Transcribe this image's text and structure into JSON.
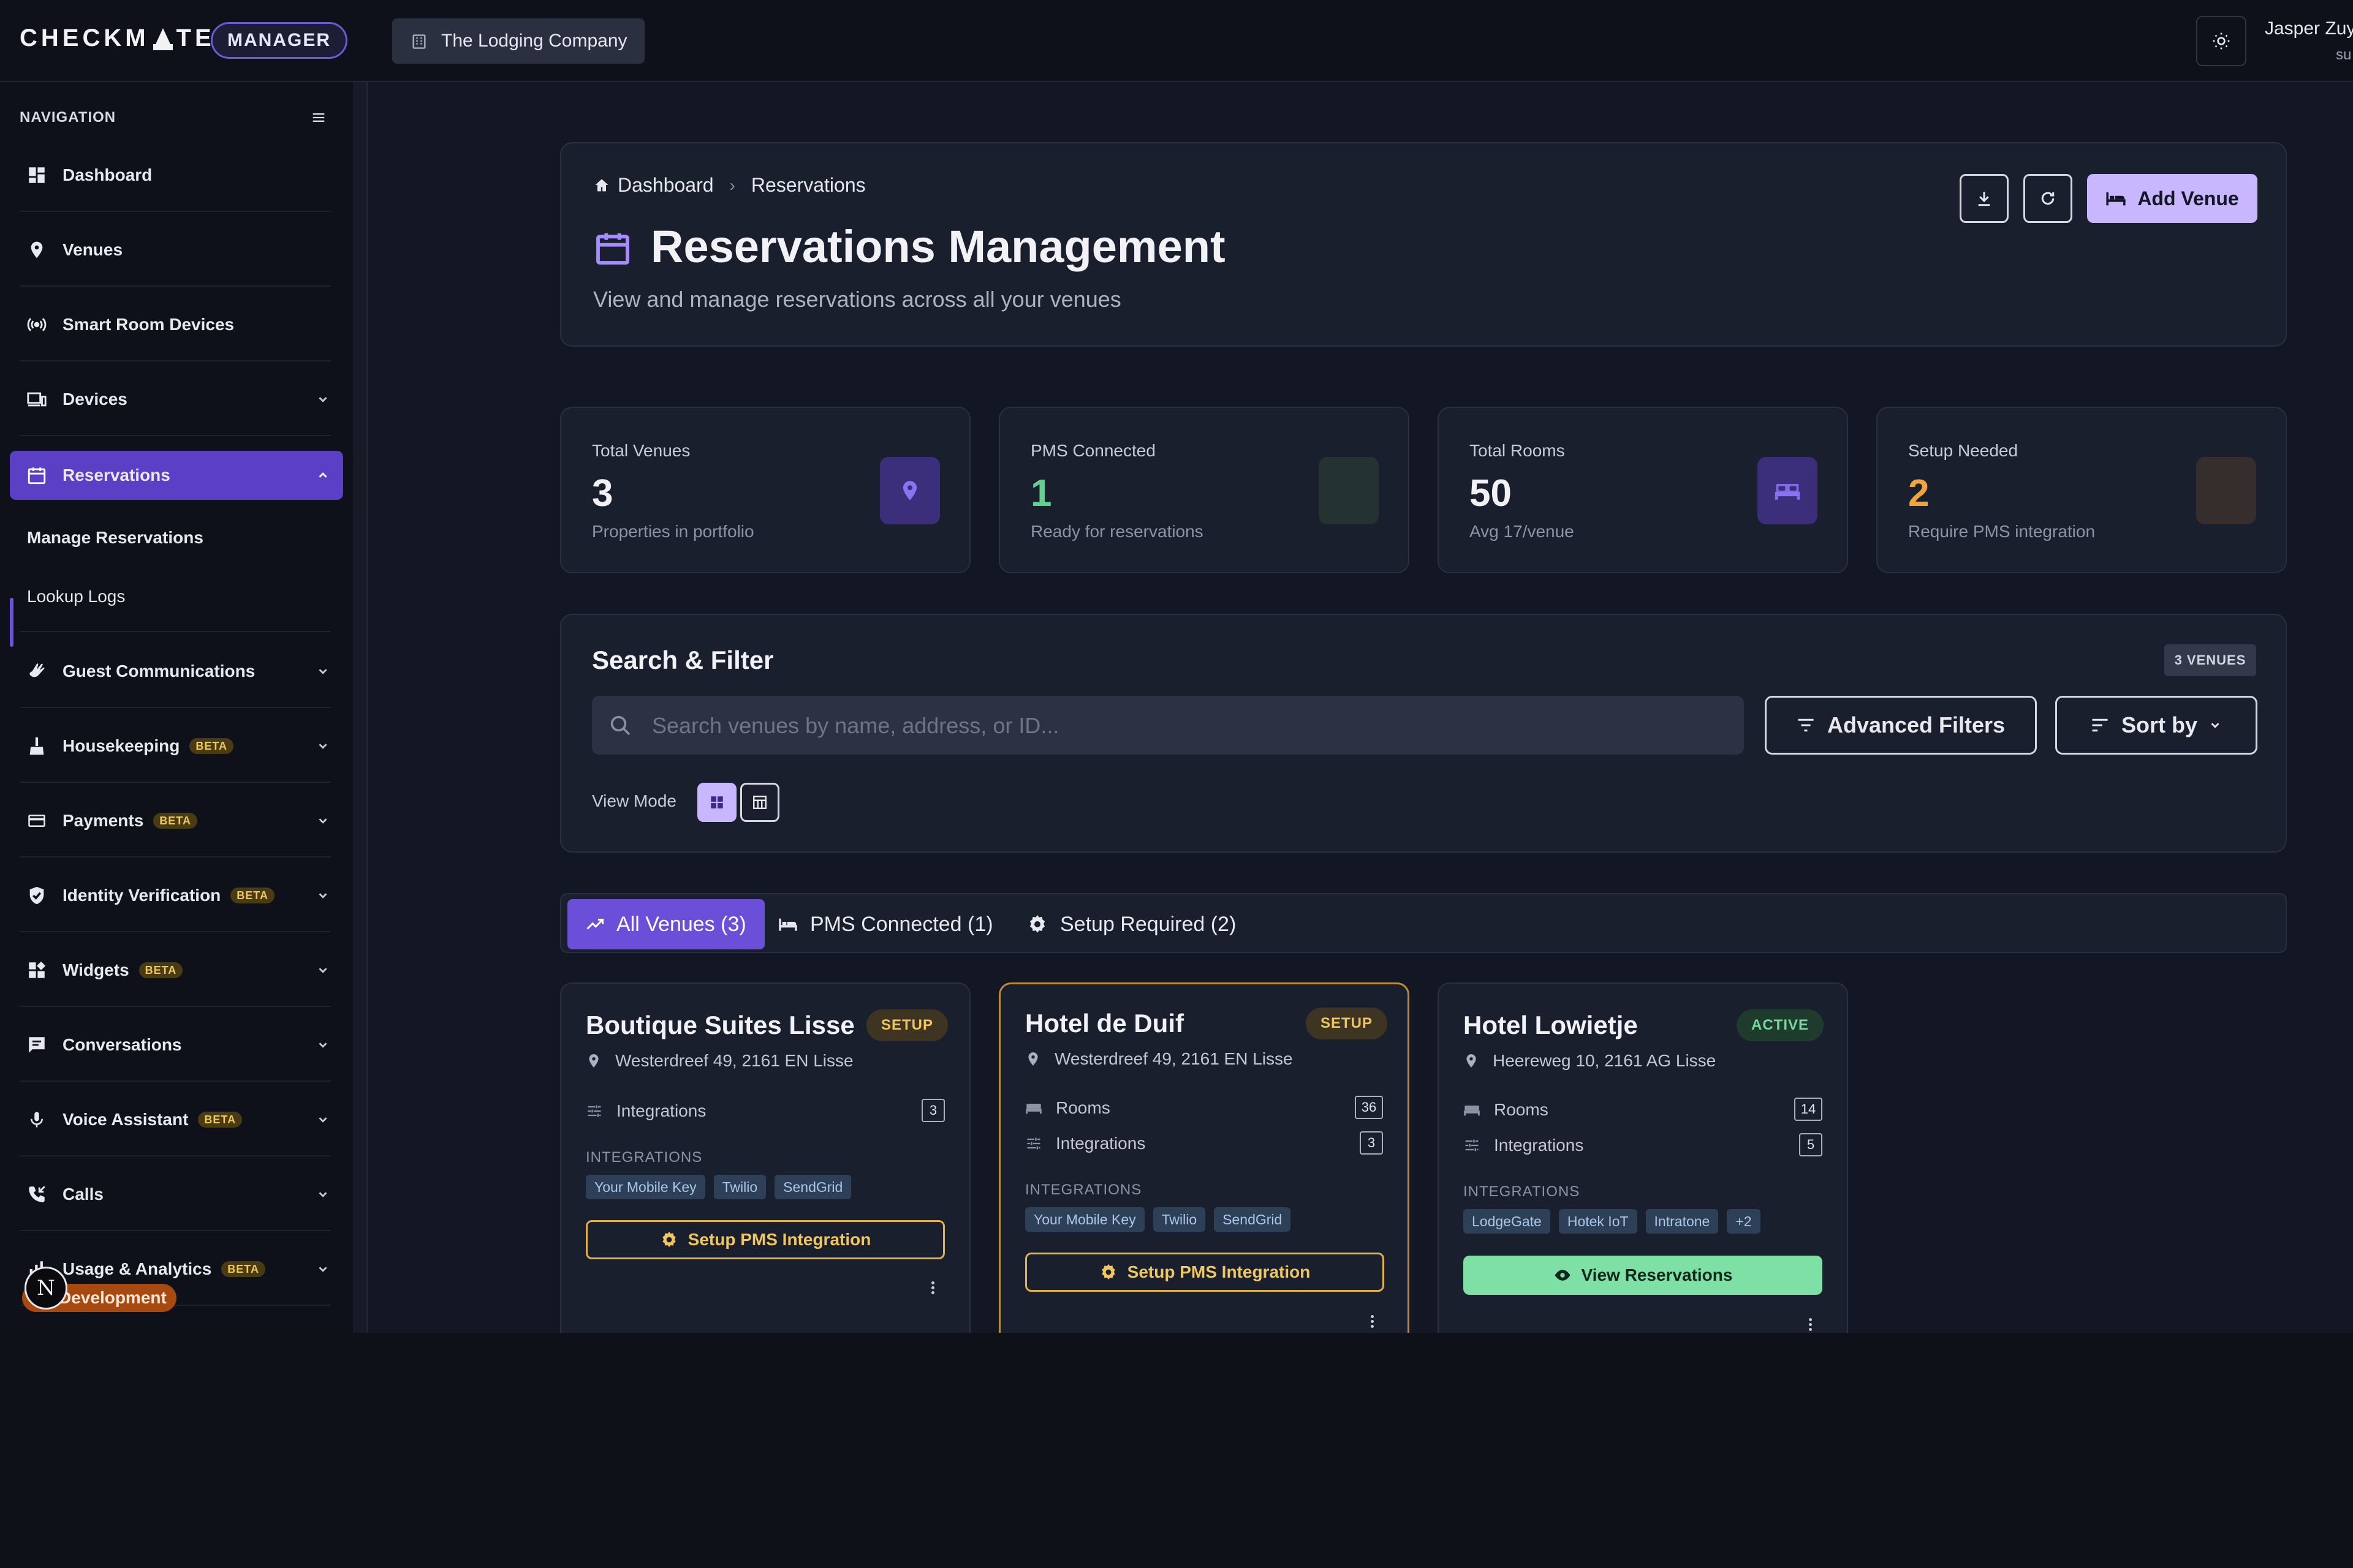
{
  "topbar": {
    "brand": "CHECKM",
    "brand_end": "TE",
    "role_pill": "MANAGER",
    "org": "The Lodging Company",
    "user_name": "Jasper Zuyd",
    "user_role": "su"
  },
  "sidebar": {
    "heading": "NAVIGATION",
    "items": [
      {
        "label": "Dashboard",
        "icon": "dashboard-icon"
      },
      {
        "label": "Venues",
        "icon": "location-pin-icon"
      },
      {
        "label": "Smart Room Devices",
        "icon": "broadcast-icon"
      },
      {
        "label": "Devices",
        "icon": "devices-icon"
      },
      {
        "label": "Reservations",
        "icon": "calendar-icon"
      },
      {
        "label": "Guest Communications",
        "icon": "wave-hand-icon"
      },
      {
        "label": "Housekeeping",
        "icon": "broom-icon",
        "badge": "BETA"
      },
      {
        "label": "Payments",
        "icon": "credit-card-icon",
        "badge": "BETA"
      },
      {
        "label": "Identity Verification",
        "icon": "shield-check-icon",
        "badge": "BETA"
      },
      {
        "label": "Widgets",
        "icon": "widgets-icon",
        "badge": "BETA"
      },
      {
        "label": "Conversations",
        "icon": "chat-icon"
      },
      {
        "label": "Voice Assistant",
        "icon": "microphone-icon",
        "badge": "BETA"
      },
      {
        "label": "Calls",
        "icon": "phone-callback-icon"
      },
      {
        "label": "Usage & Analytics",
        "icon": "analytics-icon",
        "badge": "BETA"
      }
    ],
    "sub_items": [
      "Manage Reservations",
      "Lookup Logs"
    ],
    "dev_pill": "Development",
    "n_badge": "N"
  },
  "header": {
    "breadcrumb_home": "Dashboard",
    "breadcrumb_current": "Reservations",
    "title": "Reservations Management",
    "subtitle": "View and manage reservations across all your venues",
    "add_label": "Add Venue"
  },
  "stats": [
    {
      "label": "Total Venues",
      "value": "3",
      "note": "Properties in portfolio",
      "color": "#f1f1f6"
    },
    {
      "label": "PMS Connected",
      "value": "1",
      "note": "Ready for reservations",
      "color": "#62d18f"
    },
    {
      "label": "Total Rooms",
      "value": "50",
      "note": "Avg 17/venue",
      "color": "#f1f1f6"
    },
    {
      "label": "Setup Needed",
      "value": "2",
      "note": "Require PMS integration",
      "color": "#f2a33a"
    }
  ],
  "filter": {
    "title": "Search & Filter",
    "count_badge": "3 VENUES",
    "search_placeholder": "Search venues by name, address, or ID...",
    "advanced_label": "Advanced Filters",
    "sort_label": "Sort by",
    "view_mode_label": "View Mode"
  },
  "tabs": [
    {
      "label": "All Venues (3)"
    },
    {
      "label": "PMS Connected (1)"
    },
    {
      "label": "Setup Required (2)"
    }
  ],
  "venues": [
    {
      "name": "Boutique Suites Lisse",
      "status": "SETUP",
      "address": "Westerdreef 49, 2161 EN Lisse",
      "integrations_label": "Integrations",
      "integrations_count": "3",
      "section": "INTEGRATIONS",
      "tags": [
        "Your Mobile Key",
        "Twilio",
        "SendGrid"
      ],
      "action": "Setup PMS Integration"
    },
    {
      "name": "Hotel de Duif",
      "status": "SETUP",
      "address": "Westerdreef 49, 2161 EN Lisse",
      "rooms_label": "Rooms",
      "rooms_count": "36",
      "integrations_label": "Integrations",
      "integrations_count": "3",
      "section": "INTEGRATIONS",
      "tags": [
        "Your Mobile Key",
        "Twilio",
        "SendGrid"
      ],
      "action": "Setup PMS Integration"
    },
    {
      "name": "Hotel Lowietje",
      "status": "ACTIVE",
      "address": "Heereweg 10, 2161 AG Lisse",
      "rooms_label": "Rooms",
      "rooms_count": "14",
      "integrations_label": "Integrations",
      "integrations_count": "5",
      "section": "INTEGRATIONS",
      "tags": [
        "LodgeGate",
        "Hotek IoT",
        "Intratone",
        "+2"
      ],
      "action": "View Reservations"
    }
  ],
  "colors": {
    "accent": "#6b4fd8",
    "accent_light": "#c8b6ff",
    "warning": "#f0c75e",
    "success": "#7ee0a4"
  }
}
